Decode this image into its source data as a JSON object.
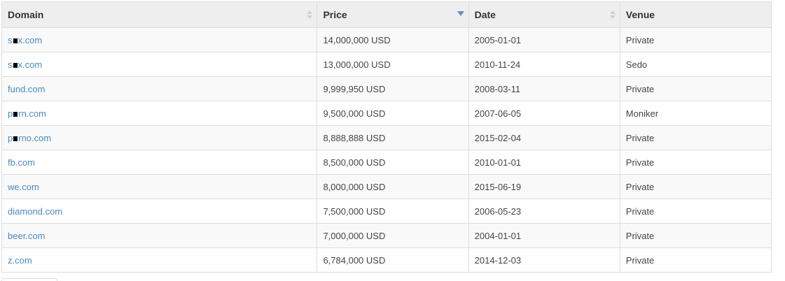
{
  "table": {
    "columns": [
      {
        "label": "Domain",
        "sort": "none"
      },
      {
        "label": "Price",
        "sort": "descending"
      },
      {
        "label": "Date",
        "sort": "none"
      },
      {
        "label": "Venue",
        "sort": "none"
      }
    ],
    "rows": [
      {
        "domain_pre": "s",
        "domain_post": "x.com",
        "censored": true,
        "price": "14,000,000 USD",
        "date": "2005-01-01",
        "venue": "Private"
      },
      {
        "domain_pre": "s",
        "domain_post": "x.com",
        "censored": true,
        "price": "13,000,000 USD",
        "date": "2010-11-24",
        "venue": "Sedo"
      },
      {
        "domain_pre": "fund.com",
        "domain_post": "",
        "censored": false,
        "price": "9,999,950 USD",
        "date": "2008-03-11",
        "venue": "Private"
      },
      {
        "domain_pre": "p",
        "domain_post": "rn.com",
        "censored": true,
        "price": "9,500,000 USD",
        "date": "2007-06-05",
        "venue": "Moniker"
      },
      {
        "domain_pre": "p",
        "domain_post": "rno.com",
        "censored": true,
        "price": "8,888,888 USD",
        "date": "2015-02-04",
        "venue": "Private"
      },
      {
        "domain_pre": "fb.com",
        "domain_post": "",
        "censored": false,
        "price": "8,500,000 USD",
        "date": "2010-01-01",
        "venue": "Private"
      },
      {
        "domain_pre": "we.com",
        "domain_post": "",
        "censored": false,
        "price": "8,000,000 USD",
        "date": "2015-06-19",
        "venue": "Private"
      },
      {
        "domain_pre": "diamond.com",
        "domain_post": "",
        "censored": false,
        "price": "7,500,000 USD",
        "date": "2006-05-23",
        "venue": "Private"
      },
      {
        "domain_pre": "beer.com",
        "domain_post": "",
        "censored": false,
        "price": "7,000,000 USD",
        "date": "2004-01-01",
        "venue": "Private"
      },
      {
        "domain_pre": "z.com",
        "domain_post": "",
        "censored": false,
        "price": "6,784,000 USD",
        "date": "2014-12-03",
        "venue": "Private"
      }
    ]
  },
  "colors": {
    "link": "#4a8ac4",
    "header_bg": "#eeeeee",
    "row_stripe": "#f9f9f9",
    "border": "#dddddd",
    "sort_active": "#7a86c9"
  }
}
